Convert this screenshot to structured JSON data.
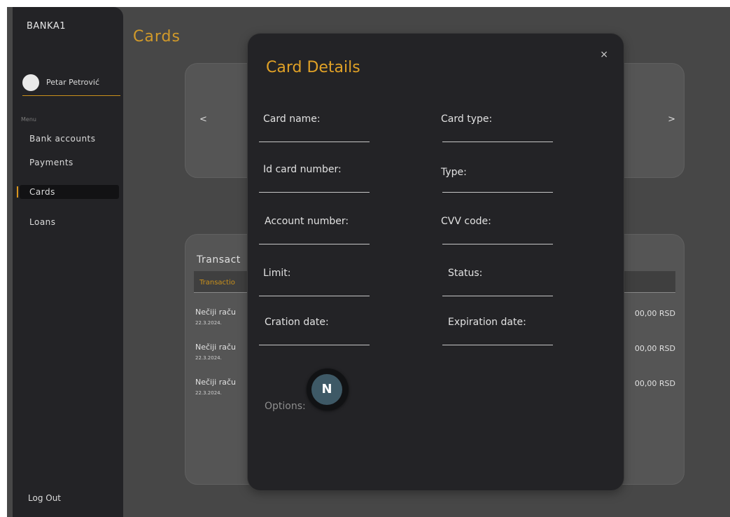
{
  "sidebar": {
    "brand": "BANKA1",
    "user_name": "Petar Petrović",
    "menu_label": "Menu",
    "items": [
      {
        "label": "Bank accounts"
      },
      {
        "label": "Payments"
      },
      {
        "label": "Cards",
        "active": true
      },
      {
        "label": "Loans"
      }
    ],
    "logout_label": "Log Out"
  },
  "main": {
    "title": "Cards",
    "carousel": {
      "prev_label": "<",
      "next_label": ">"
    },
    "transactions": {
      "title": "Transact",
      "header_label": "Transactio",
      "rows": [
        {
          "name": "Nečiji raču",
          "date": "22.3.2024.",
          "amount": "00,00 RSD"
        },
        {
          "name": "Nečiji raču",
          "date": "22.3.2024.",
          "amount": "00,00 RSD"
        },
        {
          "name": "Nečiji raču",
          "date": "22.3.2024.",
          "amount": "00,00 RSD"
        }
      ]
    }
  },
  "modal": {
    "title": "Card Details",
    "close_label": "×",
    "fields": {
      "card_name": "Card name:",
      "card_type": "Card type:",
      "id_card_number": "Id card number:",
      "type": "Type:",
      "account_number": "Account number:",
      "cvv_code": "CVV code:",
      "limit": "Limit:",
      "status": "Status:",
      "creation_date": "Cration date:",
      "expiration_date": "Expiration date:"
    },
    "options_label": "Options:",
    "badge_letter": "N"
  },
  "colors": {
    "accent": "#d9961f",
    "sidebar_bg": "#232326",
    "page_bg": "#474747",
    "modal_bg": "#232326",
    "badge": "#3e5966"
  },
  "icons": {
    "close": "close-icon",
    "prev": "chevron-left-icon",
    "next": "chevron-right-icon"
  }
}
